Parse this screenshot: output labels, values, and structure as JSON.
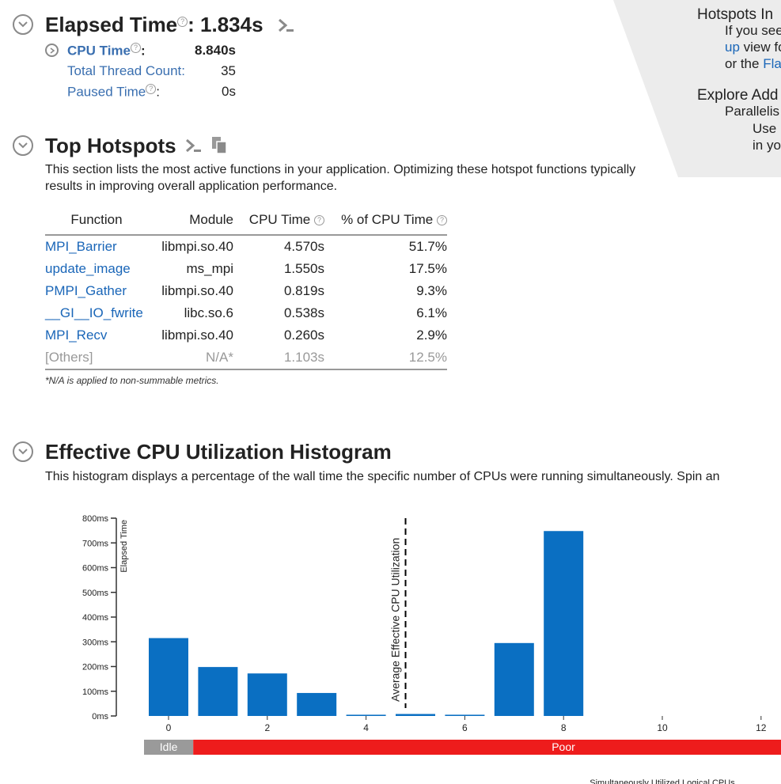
{
  "summary": {
    "elapsed_label": "Elapsed Time",
    "elapsed_value": ": 1.834s",
    "cpu_time_label": "CPU Time",
    "cpu_time_suffix": ":",
    "cpu_time_value": "8.840s",
    "total_thread_label": "Total Thread Count:",
    "total_thread_value": "35",
    "paused_label": "Paused Time",
    "paused_suffix": ":",
    "paused_value": "0s"
  },
  "hotspots": {
    "title": "Top Hotspots",
    "description": "This section lists the most active functions in your application. Optimizing these hotspot functions typically results in improving overall application performance.",
    "columns": [
      "Function",
      "Module",
      "CPU Time",
      "% of CPU Time"
    ],
    "rows": [
      {
        "function": "MPI_Barrier",
        "module": "libmpi.so.40",
        "cpu": "4.570s",
        "pct": "51.7%"
      },
      {
        "function": "update_image",
        "module": "ms_mpi",
        "cpu": "1.550s",
        "pct": "17.5%"
      },
      {
        "function": "PMPI_Gather",
        "module": "libmpi.so.40",
        "cpu": "0.819s",
        "pct": "9.3%"
      },
      {
        "function": "__GI__IO_fwrite",
        "module": "libc.so.6",
        "cpu": "0.538s",
        "pct": "6.1%"
      },
      {
        "function": "MPI_Recv",
        "module": "libmpi.so.40",
        "cpu": "0.260s",
        "pct": "2.9%"
      },
      {
        "function": "[Others]",
        "module": "N/A*",
        "cpu": "1.103s",
        "pct": "12.5%"
      }
    ],
    "footnote": "*N/A is applied to non-summable metrics."
  },
  "histogram": {
    "title": "Effective CPU Utilization Histogram",
    "description": "This histogram displays a percentage of the wall time the specific number of CPUs were running simultaneously. Spin an"
  },
  "right_panel": {
    "line1": "Hotspots In",
    "line2": "If you see",
    "line3_link": "up",
    "line3_rest": " view fo",
    "line4_pre": "or the ",
    "line4_link": "Fla",
    "line5": "Explore Add",
    "line6": "Parallelis",
    "line7": "Use",
    "line8": "in yo"
  },
  "chart_data": {
    "type": "bar",
    "ylabel": "Elapsed Time",
    "xlabel": "Simultaneously Utilized Logical CPUs",
    "yticks": [
      "0ms",
      "100ms",
      "200ms",
      "300ms",
      "400ms",
      "500ms",
      "600ms",
      "700ms",
      "800ms"
    ],
    "ylim": [
      0,
      800
    ],
    "xticks": [
      "0",
      "2",
      "4",
      "6",
      "8",
      "10",
      "12"
    ],
    "x": [
      0,
      1,
      2,
      3,
      4,
      5,
      6,
      7,
      8
    ],
    "values": [
      315,
      198,
      172,
      93,
      5,
      8,
      5,
      295,
      748
    ],
    "average_label": "Average Effective CPU Utilization",
    "average_value": 4.8,
    "bar_color": "#0a6fc2",
    "zones": [
      {
        "label": "Idle",
        "color": "#9a9a9a"
      },
      {
        "label": "Poor",
        "color": "#ee1c1c"
      }
    ]
  }
}
